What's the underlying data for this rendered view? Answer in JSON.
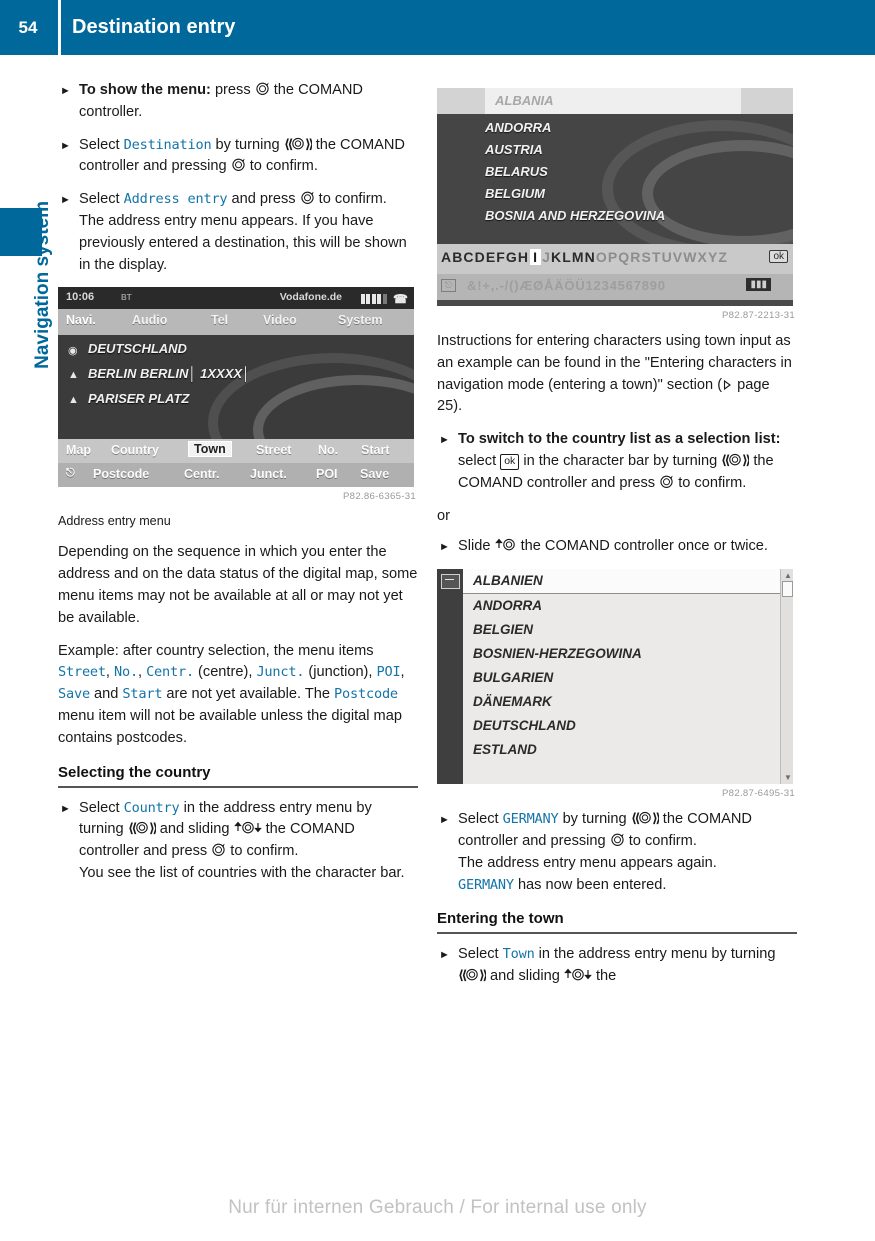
{
  "header": {
    "page_number": "54",
    "title": "Destination entry"
  },
  "edge_tab": {
    "label": "Navigation system",
    "accent_color": "#00689b"
  },
  "left_column": {
    "steps": [
      {
        "bold_lead": "To show the menu:",
        "text_after": " press  the COMAND controller."
      },
      {
        "text": "Select Destination by turning  the COMAND controller and pressing  to confirm."
      },
      {
        "text": "Select Address entry and press  to confirm.",
        "continuation": "The address entry menu appears. If you have previously entered a destination, this will be shown in the display."
      }
    ],
    "figure1": {
      "code": "P82.86-6365-31",
      "caption": "Address entry menu",
      "statusbar": {
        "time": "10:06",
        "bt": "BT",
        "network": "Vodafone.de"
      },
      "menubar": [
        "Navi.",
        "Audio",
        "Tel",
        "Video",
        "System"
      ],
      "selected_menu": "Navi.",
      "destination_lines": [
        "DEUTSCHLAND",
        "BERLIN BERLIN│ 1XXXX│",
        "PARISER PLATZ"
      ],
      "softkeys_row1": [
        "Map",
        "Country",
        "Town",
        "Street",
        "No.",
        "Start"
      ],
      "softkeys_row2": [
        "Postcode",
        "Centr.",
        "Junct.",
        "POI",
        "Save"
      ],
      "highlighted_softkey": "Town"
    },
    "paragraph_depending": "Depending on the sequence in which you enter the address and on the data status of the digital map, some menu items may not be available at all or may not yet be available.",
    "paragraph_example_parts": {
      "p1": "Example: after country selection, the menu items ",
      "m1": "Street",
      "p2": ", ",
      "m2": "No.",
      "p3": ", ",
      "m3": "Centr.",
      "p4": " (centre), ",
      "m4": "Junct.",
      "p5": " (junction), ",
      "m5": "POI",
      "p6": ", ",
      "m6": "Save",
      "p7": " and ",
      "m7": "Start",
      "p8": " are not yet available. The ",
      "m8": "Postcode",
      "p9": " menu item will not be available unless the digital map contains postcodes."
    },
    "section_heading": "Selecting the country",
    "country_step": {
      "p1": "Select ",
      "m1": "Country",
      "p2": " in the address entry menu by turning ",
      "p3": " and sliding ",
      "p4": " the COMAND controller and press ",
      "p5": " to confirm.",
      "continuation": "You see the list of countries with the character bar."
    }
  },
  "right_column": {
    "figure2": {
      "code": "P82.87-2213-31",
      "selected_row": "ALBANIA",
      "rows": [
        "ANDORRA",
        "AUSTRIA",
        "BELARUS",
        "BELGIUM",
        "BOSNIA AND HERZEGOVINA"
      ],
      "charbar_before": "ABCDEFGH",
      "charbar_cursor": "I",
      "charbar_after_dim": "J",
      "charbar_after": "KLMN",
      "charbar_after2": "OPQRST",
      "charbar_tail": "UVWXYZ",
      "ok_key": "ok",
      "charbar2": "&!+,.-/()ÆØÅÄÖÜ1234567890"
    },
    "paragraph_instructions": "Instructions for entering characters using town input as an example can be found in the \"Entering characters in navigation mode (entering a town)\" section (",
    "paragraph_instructions_page": " page 25).",
    "switch_step": {
      "bold_lead": "To switch to the country list as a selection list:",
      "p1": " select ",
      "ok_key": "ok",
      "p2": " in the character bar by turning ",
      "p3": " the COMAND controller and press ",
      "p4": " to confirm."
    },
    "or_label": "or",
    "slide_step": {
      "p1": "Slide ",
      "p2": " the COMAND controller once or twice."
    },
    "figure3": {
      "code": "P82.87-6495-31",
      "selected_row": "ALBANIEN",
      "rows": [
        "ANDORRA",
        "BELGIEN",
        "BOSNIEN-HERZEGOWINA",
        "BULGARIEN",
        "DÄNEMARK",
        "DEUTSCHLAND",
        "ESTLAND"
      ]
    },
    "germany_step": {
      "p1": "Select ",
      "m1": "GERMANY",
      "p2": " by turning ",
      "p3": " the COMAND controller and pressing ",
      "p4": " to confirm.",
      "c1": "The address entry menu appears again. ",
      "m2": "GERMANY",
      "c2": " has now been entered."
    },
    "section_heading": "Entering the town",
    "town_step": {
      "p1": "Select ",
      "m1": "Town",
      "p2": " in the address entry menu by turning ",
      "p3": " and sliding ",
      "p4": " the"
    }
  },
  "footer": {
    "text": "Nur für internen Gebrauch / For internal use only"
  }
}
